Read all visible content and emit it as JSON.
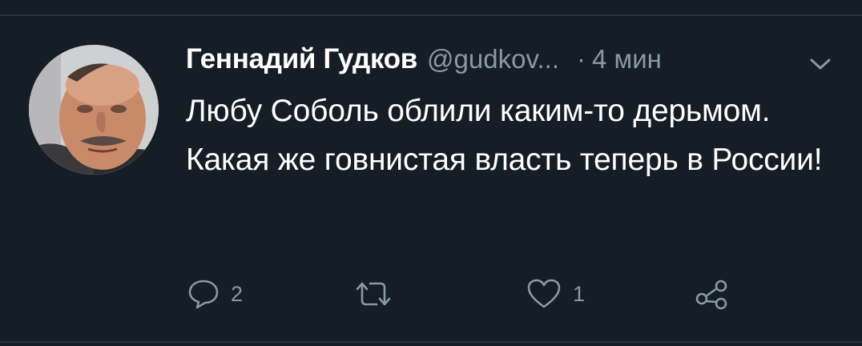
{
  "tweet": {
    "display_name": "Геннадий Гудков",
    "handle": "@gudkov...",
    "separator": "·",
    "time": "4 мин",
    "text": "Любу Соболь облили каким-то дерьмом. Какая же говнистая власть теперь в России!"
  },
  "actions": {
    "reply_count": "2",
    "like_count": "1"
  },
  "icons": {
    "reply": "reply-icon",
    "retweet": "retweet-icon",
    "like": "like-icon",
    "share": "share-icon",
    "chevron": "chevron-down-icon"
  },
  "colors": {
    "background": "#151d26",
    "secondary_text": "#8899a6",
    "primary_text": "#ffffff",
    "divider": "#23303d"
  }
}
